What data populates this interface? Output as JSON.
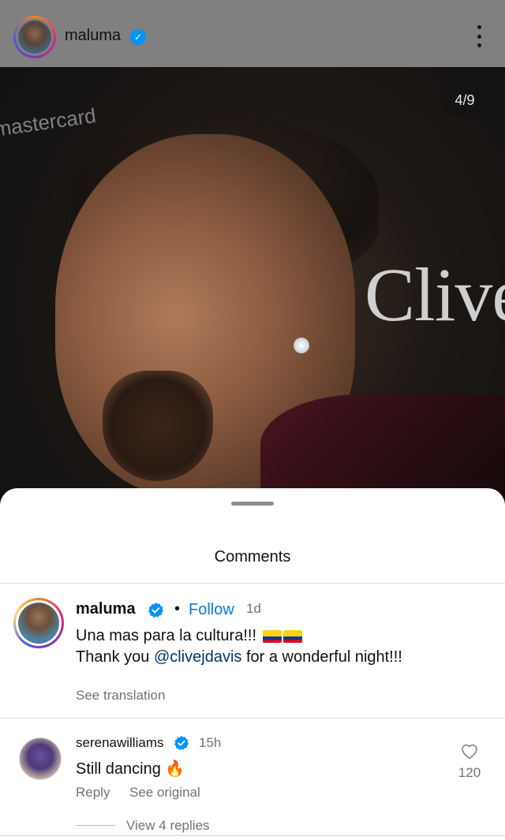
{
  "post": {
    "username": "maluma",
    "counter": "4/9"
  },
  "sheet": {
    "title": "Comments"
  },
  "caption": {
    "username": "maluma",
    "separator": "•",
    "follow_label": "Follow",
    "time": "1d",
    "line1": "Una mas para la cultura!!!",
    "line2_prefix": "Thank you ",
    "mention": "@clivejdavis",
    "line2_suffix": " for a wonderful night!!!",
    "see_translation": "See translation"
  },
  "comment": {
    "username": "serenawilliams",
    "time": "15h",
    "text": "Still dancing 🔥",
    "reply_label": "Reply",
    "see_original": "See original",
    "likes": "120",
    "view_replies": "View 4 replies"
  },
  "colors": {
    "verified": "#0095f6",
    "follow": "#0a7ad6",
    "mention": "#00376b"
  },
  "icons": [
    "verified-icon",
    "more-options-icon",
    "heart-icon",
    "colombia-flag-icon"
  ]
}
